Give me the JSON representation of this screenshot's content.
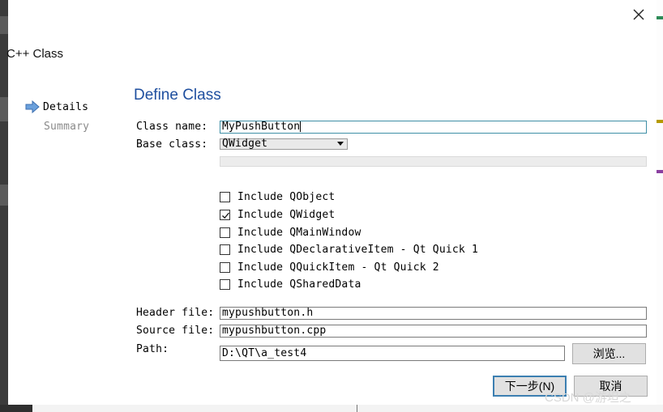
{
  "dialog": {
    "window_title": "C++ Class",
    "nav": {
      "details": "Details",
      "summary": "Summary"
    },
    "page_title": "Define Class",
    "labels": {
      "class_name": "Class name:",
      "base_class": "Base class:",
      "header_file": "Header file:",
      "source_file": "Source file:",
      "path": "Path:"
    },
    "fields": {
      "class_name": "MyPushButton",
      "base_class": "QWidget",
      "header_file": "mypushbutton.h",
      "source_file": "mypushbutton.cpp",
      "path": "D:\\QT\\a_test4"
    },
    "checkboxes": [
      {
        "label": "Include QObject",
        "checked": false
      },
      {
        "label": "Include QWidget",
        "checked": true
      },
      {
        "label": "Include QMainWindow",
        "checked": false
      },
      {
        "label": "Include QDeclarativeItem - Qt Quick 1",
        "checked": false
      },
      {
        "label": "Include QQuickItem - Qt Quick 2",
        "checked": false
      },
      {
        "label": "Include QSharedData",
        "checked": false
      }
    ],
    "buttons": {
      "browse": "浏览...",
      "next": "下一步(N)",
      "cancel": "取消"
    }
  },
  "watermark": "CSDN @游坦之",
  "colors": {
    "title_blue": "#1f4f9f",
    "focus_border": "#3f8fa6",
    "default_button_border": "#3c7fb1"
  },
  "icons": {
    "close": "close-icon",
    "nav_arrow": "arrow-right-icon",
    "dropdown": "chevron-down-icon",
    "check": "checkmark-icon"
  }
}
